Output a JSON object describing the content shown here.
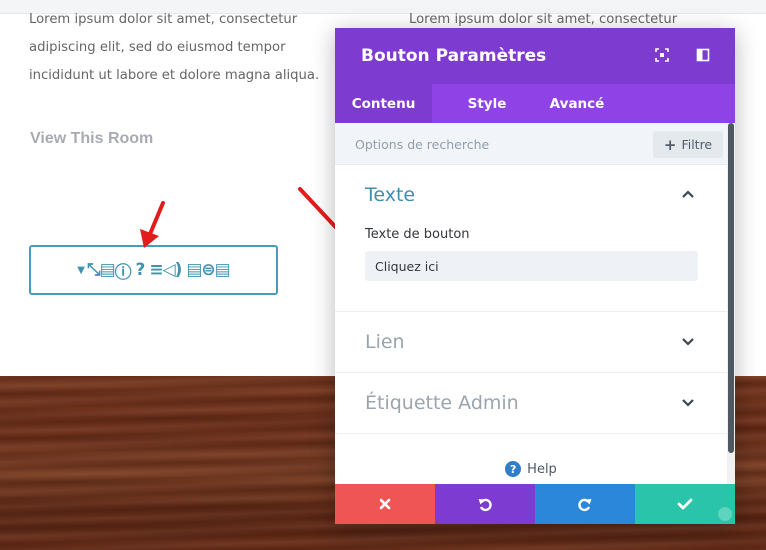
{
  "page": {
    "lorem_left": "Lorem ipsum dolor sit amet, consectetur adipiscing elit, sed do eiusmod tempor incididunt ut labore et dolore magna aliqua.",
    "lorem_right": "Lorem ipsum dolor sit amet, consectetur",
    "view_room": "View This Room",
    "icon_button_glyphs": "▼ ⤡▤ⓘ ? ≡🔈 ▤⊜▤"
  },
  "modal": {
    "title": "Bouton Paramètres",
    "header_icons": [
      "expand-icon",
      "split-view-icon"
    ],
    "tabs": [
      {
        "label": "Contenu",
        "active": true
      },
      {
        "label": "Style",
        "active": false
      },
      {
        "label": "Avancé",
        "active": false
      }
    ],
    "search": {
      "placeholder": "Options de recherche",
      "filter_label": "Filtre"
    },
    "sections": {
      "texte": {
        "title": "Texte",
        "expanded": true,
        "field_label": "Texte de bouton",
        "field_value": "Cliquez ici"
      },
      "lien": {
        "title": "Lien",
        "expanded": false
      },
      "admin": {
        "title": "Étiquette Admin",
        "expanded": false
      }
    },
    "help_label": "Help",
    "footer": [
      "close-icon",
      "undo-icon",
      "redo-icon",
      "check-icon"
    ]
  },
  "colors": {
    "header_purple": "#7e3bd0",
    "tabs_purple": "#8f42e6",
    "accent_blue": "#3e8eae",
    "close_red": "#ef5555",
    "redo_blue": "#2b87da",
    "save_green": "#29c4a9",
    "arrow_red": "#e31b1b"
  }
}
